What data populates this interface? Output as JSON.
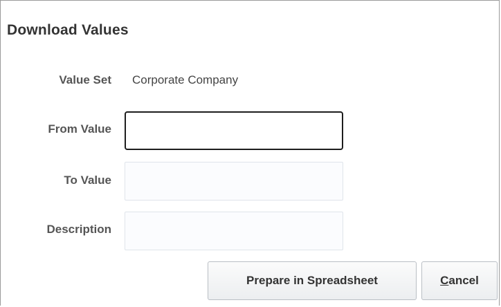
{
  "dialog": {
    "title": "Download Values"
  },
  "form": {
    "value_set_label": "Value Set",
    "value_set_value": "Corporate Company",
    "from_value_label": "From Value",
    "from_value": "",
    "to_value_label": "To Value",
    "to_value": "",
    "description_label": "Description",
    "description": ""
  },
  "buttons": {
    "prepare_label": "Prepare in Spreadsheet",
    "cancel_mnemonic": "C",
    "cancel_rest": "ancel"
  }
}
